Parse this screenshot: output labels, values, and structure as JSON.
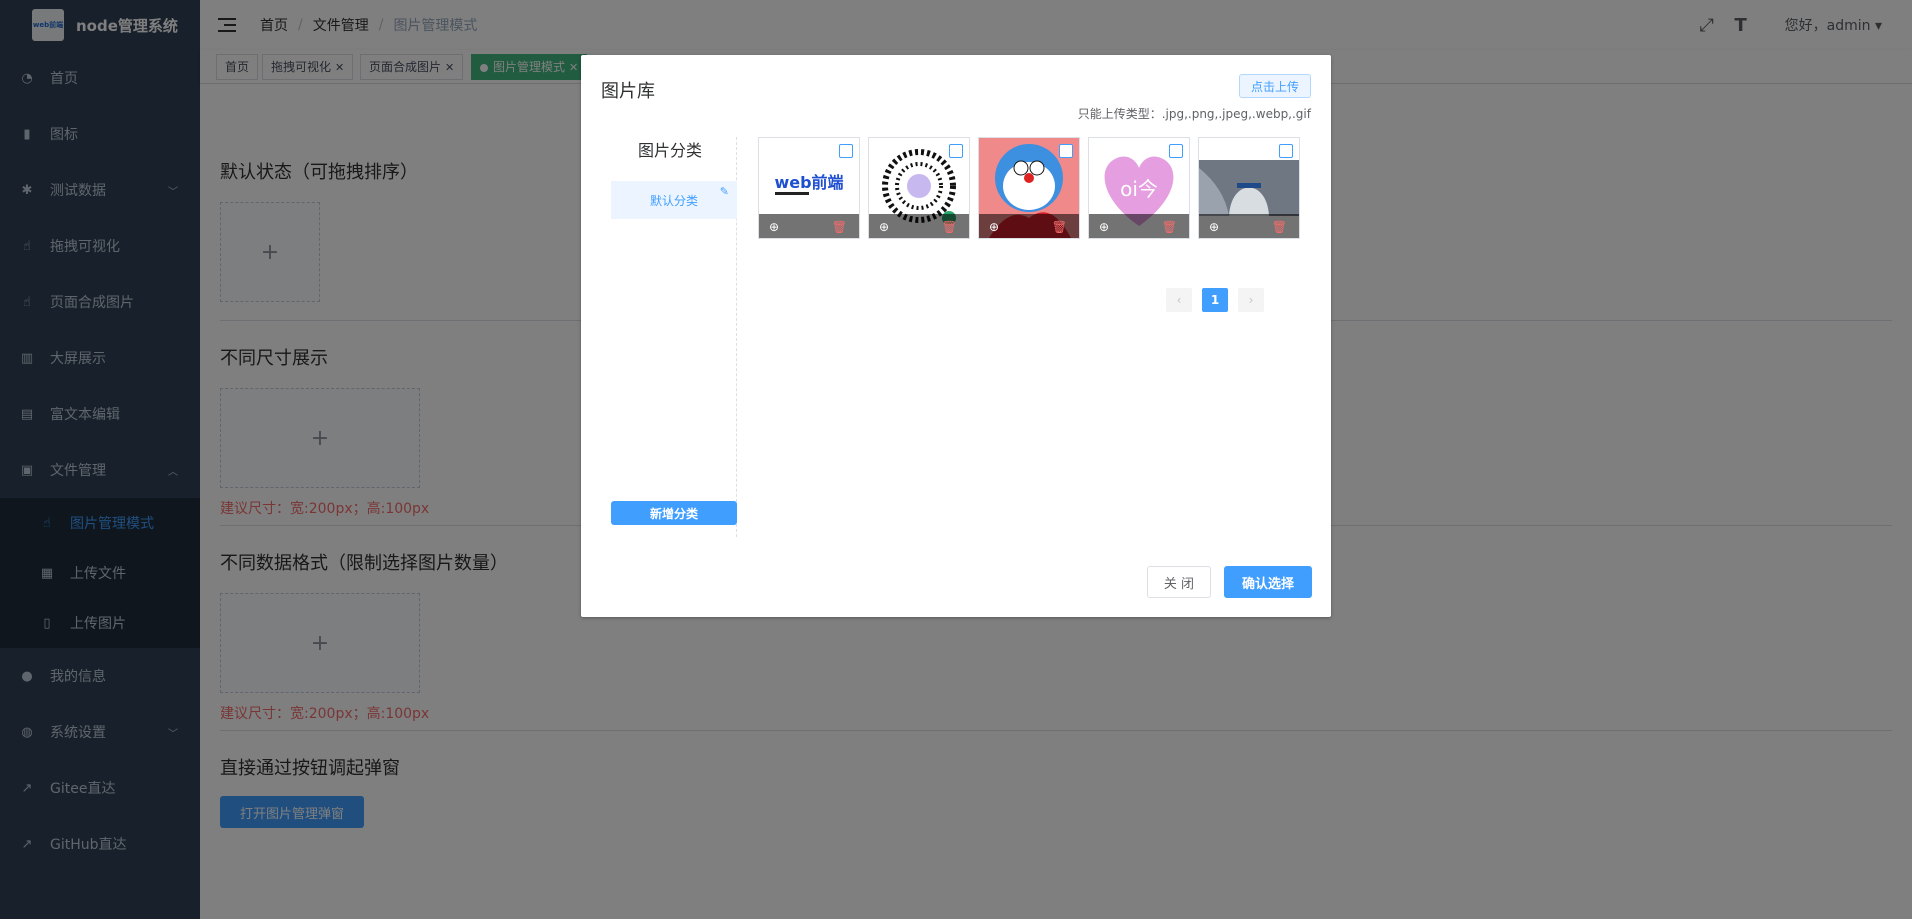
{
  "app": {
    "title": "node管理系统",
    "logo_text": "web前端"
  },
  "sidebar": {
    "items": [
      {
        "label": "首页",
        "icon": "dashboard-icon"
      },
      {
        "label": "图标",
        "icon": "info-icon"
      },
      {
        "label": "测试数据",
        "icon": "bug-icon",
        "arrow": "﹀"
      },
      {
        "label": "拖拽可视化",
        "icon": "drag-icon"
      },
      {
        "label": "页面合成图片",
        "icon": "drag-icon"
      },
      {
        "label": "大屏展示",
        "icon": "chart-icon"
      },
      {
        "label": "富文本编辑",
        "icon": "document-icon"
      },
      {
        "label": "文件管理",
        "icon": "file-manage-icon",
        "arrow": "︿"
      }
    ],
    "submenu": [
      {
        "label": "图片管理模式",
        "icon": "drag-icon",
        "active": true
      },
      {
        "label": "上传文件",
        "icon": "upload-file-icon"
      },
      {
        "label": "上传图片",
        "icon": "book-icon"
      }
    ],
    "bottom_items": [
      {
        "label": "我的信息",
        "icon": "user-icon"
      },
      {
        "label": "系统设置",
        "icon": "settings-icon",
        "arrow": "﹀"
      },
      {
        "label": "Gitee直达",
        "icon": "external-link-icon"
      },
      {
        "label": "GitHub直达",
        "icon": "external-link-icon"
      }
    ]
  },
  "header": {
    "breadcrumb": [
      "首页",
      "文件管理",
      "图片管理模式"
    ],
    "greeting": "您好，admin"
  },
  "tags": [
    {
      "label": "首页"
    },
    {
      "label": "拖拽可视化",
      "closable": true
    },
    {
      "label": "页面合成图片",
      "closable": true
    },
    {
      "label": "图片管理模式",
      "closable": true,
      "active": true
    }
  ],
  "main": {
    "sections": [
      {
        "title": "默认状态（可拖拽排序）"
      },
      {
        "title": "不同尺寸展示",
        "hint": "建议尺寸：宽:200px；高:100px"
      },
      {
        "title": "不同数据格式（限制选择图片数量）",
        "hint": "建议尺寸：宽:200px；高:100px"
      },
      {
        "title": "直接通过按钮调起弹窗"
      }
    ],
    "plus": "+",
    "open_button": "打开图片管理弹窗"
  },
  "dialog": {
    "title": "图片库",
    "upload_button": "点击上传",
    "allowed_types": "只能上传类型：.jpg,.png,.jpeg,.webp,.gif",
    "category_title": "图片分类",
    "categories": [
      "默认分类"
    ],
    "add_category": "新增分类",
    "images": [
      {
        "caption": "web前端"
      },
      {
        "caption": ""
      },
      {
        "caption": ""
      },
      {
        "caption": "oi今"
      },
      {
        "caption": ""
      }
    ],
    "pagination": {
      "current": "1",
      "prev": "‹",
      "next": "›"
    },
    "close_button": "关 闭",
    "confirm_button": "确认选择"
  },
  "colors": {
    "primary": "#409eff",
    "sidebar_bg": "#304156",
    "danger": "#f56c6c"
  }
}
